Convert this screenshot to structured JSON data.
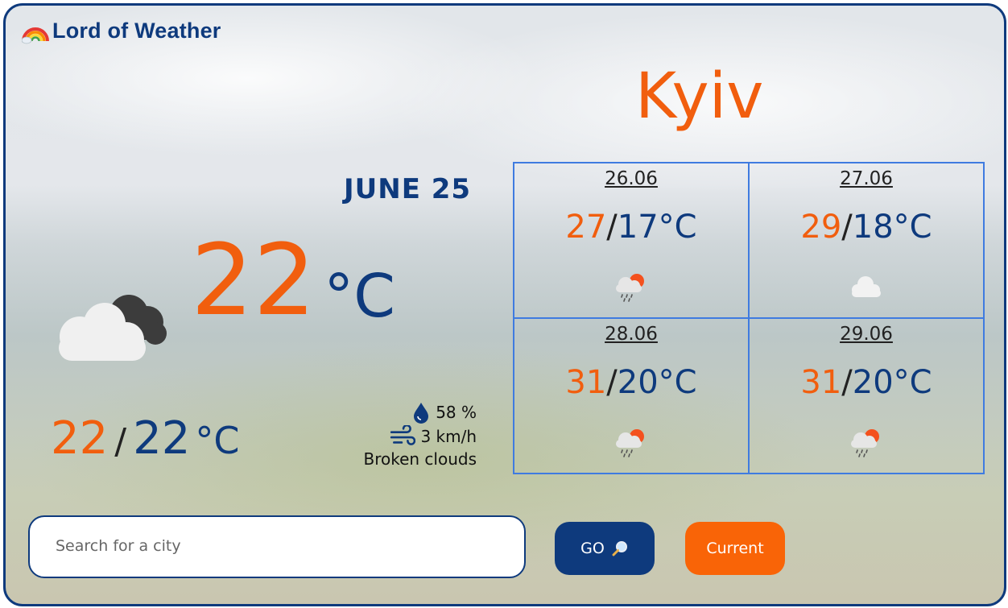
{
  "app": {
    "title": "Lord of Weather",
    "logo_icon": "rainbow-icon"
  },
  "current": {
    "city": "Kyiv",
    "date": "JUNE 25",
    "temperature": "22",
    "unit": "°C",
    "icon": "broken-clouds-icon",
    "high": "22",
    "low": "22",
    "minmax_unit": "°C",
    "separator": "/",
    "humidity": "58 %",
    "wind": "3 km/h",
    "description": "Broken clouds"
  },
  "forecast": [
    {
      "date": "26.06",
      "high": "27",
      "low": "17°C",
      "icon": "rain-sun-icon"
    },
    {
      "date": "27.06",
      "high": "29",
      "low": "18°C",
      "icon": "cloud-icon"
    },
    {
      "date": "28.06",
      "high": "31",
      "low": "20°C",
      "icon": "rain-sun-icon"
    },
    {
      "date": "29.06",
      "high": "31",
      "low": "20°C",
      "icon": "rain-sun-icon"
    }
  ],
  "search": {
    "placeholder": "Search for a city",
    "value": ""
  },
  "buttons": {
    "go_label": "GO",
    "current_label": "Current"
  },
  "colors": {
    "brand_blue": "#0e3a7d",
    "accent_orange": "#f15e0e",
    "grid_border": "#3f7be0"
  }
}
